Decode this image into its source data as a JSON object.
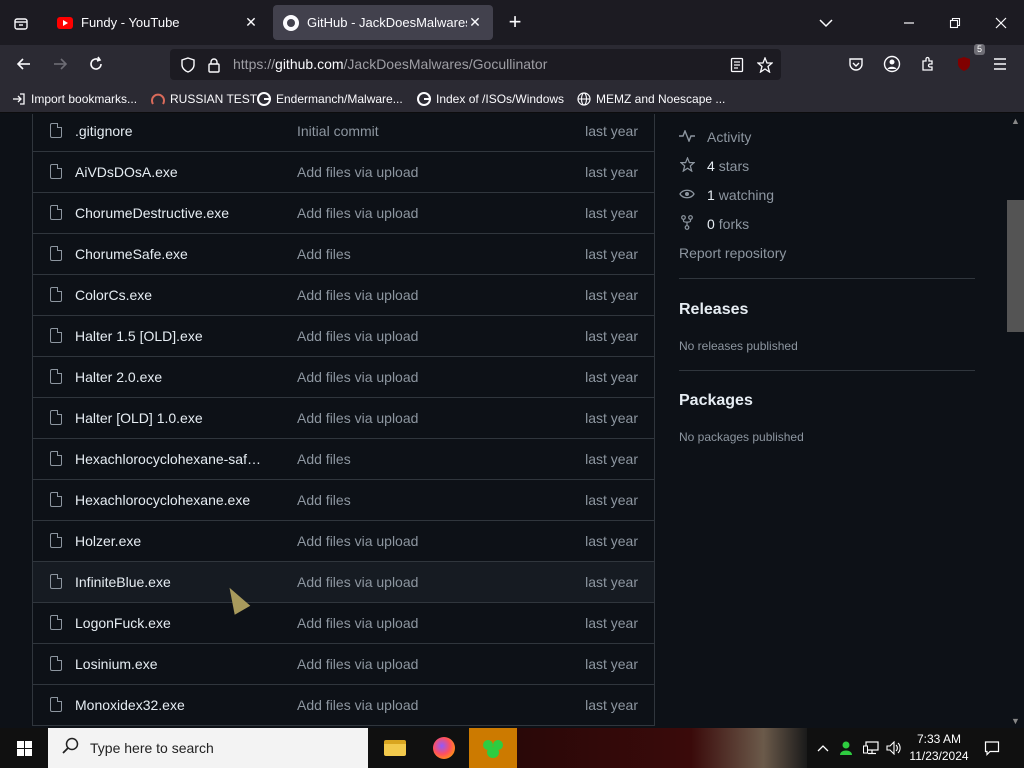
{
  "browser": {
    "tabs": [
      {
        "title": "Fundy - YouTube",
        "icon": "youtube-icon",
        "active": false
      },
      {
        "title": "GitHub - JackDoesMalwares/Gocullinator",
        "icon": "github-icon",
        "active": true
      }
    ],
    "url": {
      "scheme": "https://",
      "host": "github.com",
      "path": "/JackDoesMalwares/Gocullinator"
    },
    "extension_badge": "5",
    "bookmarks": [
      {
        "label": "Import bookmarks...",
        "icon": "import-icon"
      },
      {
        "label": "RUSSIAN TEST",
        "icon": "bookmark-site-icon"
      },
      {
        "label": "Endermanch/Malware...",
        "icon": "google-icon"
      },
      {
        "label": "Index of /ISOs/Windows",
        "icon": "google-icon"
      },
      {
        "label": "MEMZ and Noescape ...",
        "icon": "globe-icon"
      }
    ]
  },
  "files": [
    {
      "name": ".gitignore",
      "commit": "Initial commit",
      "time": "last year"
    },
    {
      "name": "AiVDsDOsA.exe",
      "commit": "Add files via upload",
      "time": "last year"
    },
    {
      "name": "ChorumeDestructive.exe",
      "commit": "Add files via upload",
      "time": "last year"
    },
    {
      "name": "ChorumeSafe.exe",
      "commit": "Add files",
      "time": "last year"
    },
    {
      "name": "ColorCs.exe",
      "commit": "Add files via upload",
      "time": "last year"
    },
    {
      "name": "Halter 1.5 [OLD].exe",
      "commit": "Add files via upload",
      "time": "last year"
    },
    {
      "name": "Halter 2.0.exe",
      "commit": "Add files via upload",
      "time": "last year"
    },
    {
      "name": "Halter [OLD] 1.0.exe",
      "commit": "Add files via upload",
      "time": "last year"
    },
    {
      "name": "Hexachlorocyclohexane-safet...",
      "commit": "Add files",
      "time": "last year"
    },
    {
      "name": "Hexachlorocyclohexane.exe",
      "commit": "Add files",
      "time": "last year"
    },
    {
      "name": "Holzer.exe",
      "commit": "Add files via upload",
      "time": "last year"
    },
    {
      "name": "InfiniteBlue.exe",
      "commit": "Add files via upload",
      "time": "last year"
    },
    {
      "name": "LogonFuck.exe",
      "commit": "Add files via upload",
      "time": "last year"
    },
    {
      "name": "Losinium.exe",
      "commit": "Add files via upload",
      "time": "last year"
    },
    {
      "name": "Monoxidex32.exe",
      "commit": "Add files via upload",
      "time": "last year"
    }
  ],
  "sidebar": {
    "activity": "Activity",
    "stars_count": "4",
    "stars_label": "stars",
    "watching_count": "1",
    "watching_label": "watching",
    "forks_count": "0",
    "forks_label": "forks",
    "report": "Report repository",
    "releases_title": "Releases",
    "releases_empty": "No releases published",
    "packages_title": "Packages",
    "packages_empty": "No packages published"
  },
  "taskbar": {
    "search_placeholder": "Type here to search",
    "time": "7:33 AM",
    "date": "11/23/2024"
  }
}
